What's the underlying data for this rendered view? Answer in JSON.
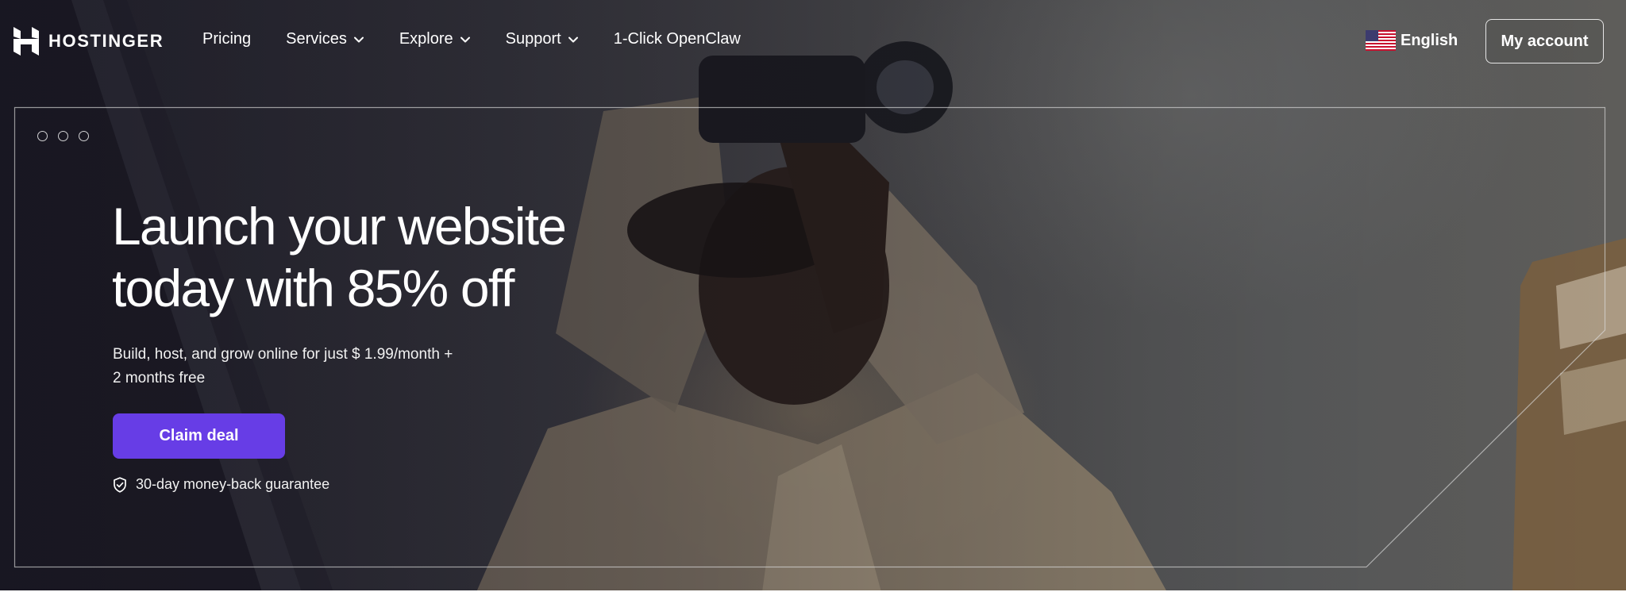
{
  "brand": {
    "name": "HOSTINGER",
    "logo_icon": "hostinger-h-logo"
  },
  "nav": {
    "items": [
      {
        "label": "Pricing",
        "has_dropdown": false
      },
      {
        "label": "Services",
        "has_dropdown": true
      },
      {
        "label": "Explore",
        "has_dropdown": true
      },
      {
        "label": "Support",
        "has_dropdown": true
      },
      {
        "label": "1-Click OpenClaw",
        "has_dropdown": false
      }
    ]
  },
  "language": {
    "label": "English",
    "flag_icon": "us-flag-icon"
  },
  "account": {
    "label": "My account"
  },
  "hero": {
    "headline_line1": "Launch your website",
    "headline_line2": "today with 85% off",
    "subtitle_line1": "Build, host, and grow online for just $ 1.99/month +",
    "subtitle_line2": "2 months free",
    "cta_label": "Claim deal",
    "guarantee_text": "30-day money-back guarantee"
  },
  "colors": {
    "accent": "#673de6",
    "text": "#ffffff",
    "frame_line": "#bdbdbd"
  }
}
